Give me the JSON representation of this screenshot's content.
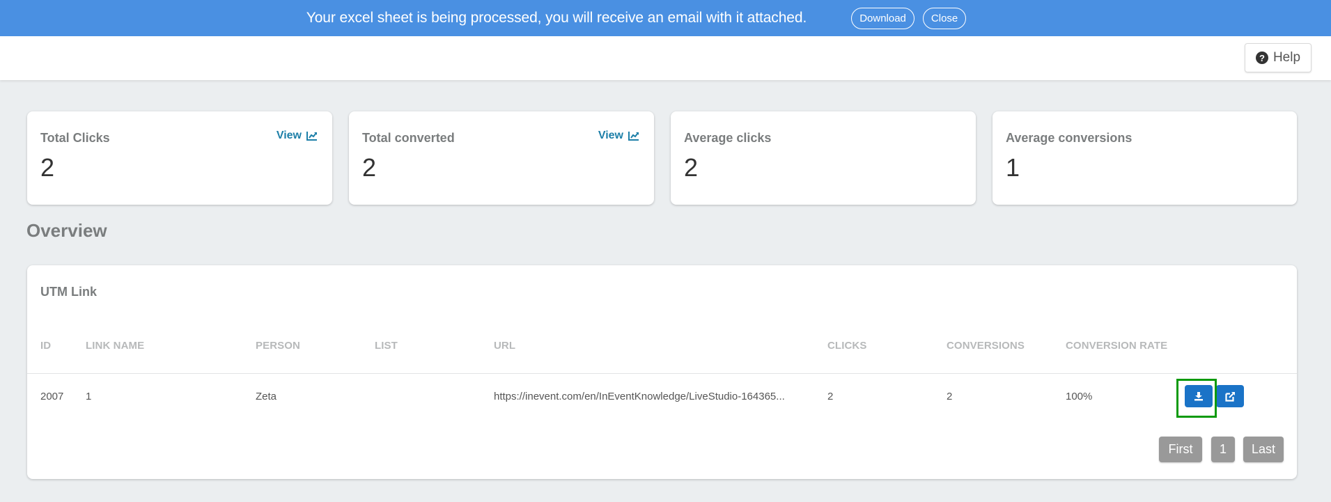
{
  "banner": {
    "message": "Your excel sheet is being processed, you will receive an email with it attached.",
    "download_label": "Download",
    "close_label": "Close"
  },
  "header": {
    "help_label": "Help",
    "help_icon": "question-circle-icon"
  },
  "stats": [
    {
      "label": "Total Clicks",
      "value": "2",
      "view_label": "View",
      "has_view": true
    },
    {
      "label": "Total converted",
      "value": "2",
      "view_label": "View",
      "has_view": true
    },
    {
      "label": "Average clicks",
      "value": "2",
      "has_view": false
    },
    {
      "label": "Average conversions",
      "value": "1",
      "has_view": false
    }
  ],
  "overview": {
    "title": "Overview",
    "card_title": "UTM Link",
    "columns": [
      "ID",
      "LINK NAME",
      "PERSON",
      "LIST",
      "URL",
      "CLICKS",
      "CONVERSIONS",
      "CONVERSION RATE"
    ],
    "rows": [
      {
        "id": "2007",
        "link_name": "1",
        "person": "Zeta",
        "list": "",
        "url": "https://inevent.com/en/InEventKnowledge/LiveStudio-164365...",
        "clicks": "2",
        "conversions": "2",
        "conversion_rate": "100%",
        "actions": [
          "download-icon",
          "external-link-icon"
        ]
      }
    ],
    "pagination": {
      "first_label": "First",
      "current_page": "1",
      "last_label": "Last"
    }
  },
  "colors": {
    "banner_bg": "#4a90e2",
    "page_bg": "#ebeef0",
    "link_color": "#1d7fa8",
    "action_button": "#1a73c7",
    "pagination_button": "#999999",
    "highlight": "#0b9a0b"
  }
}
